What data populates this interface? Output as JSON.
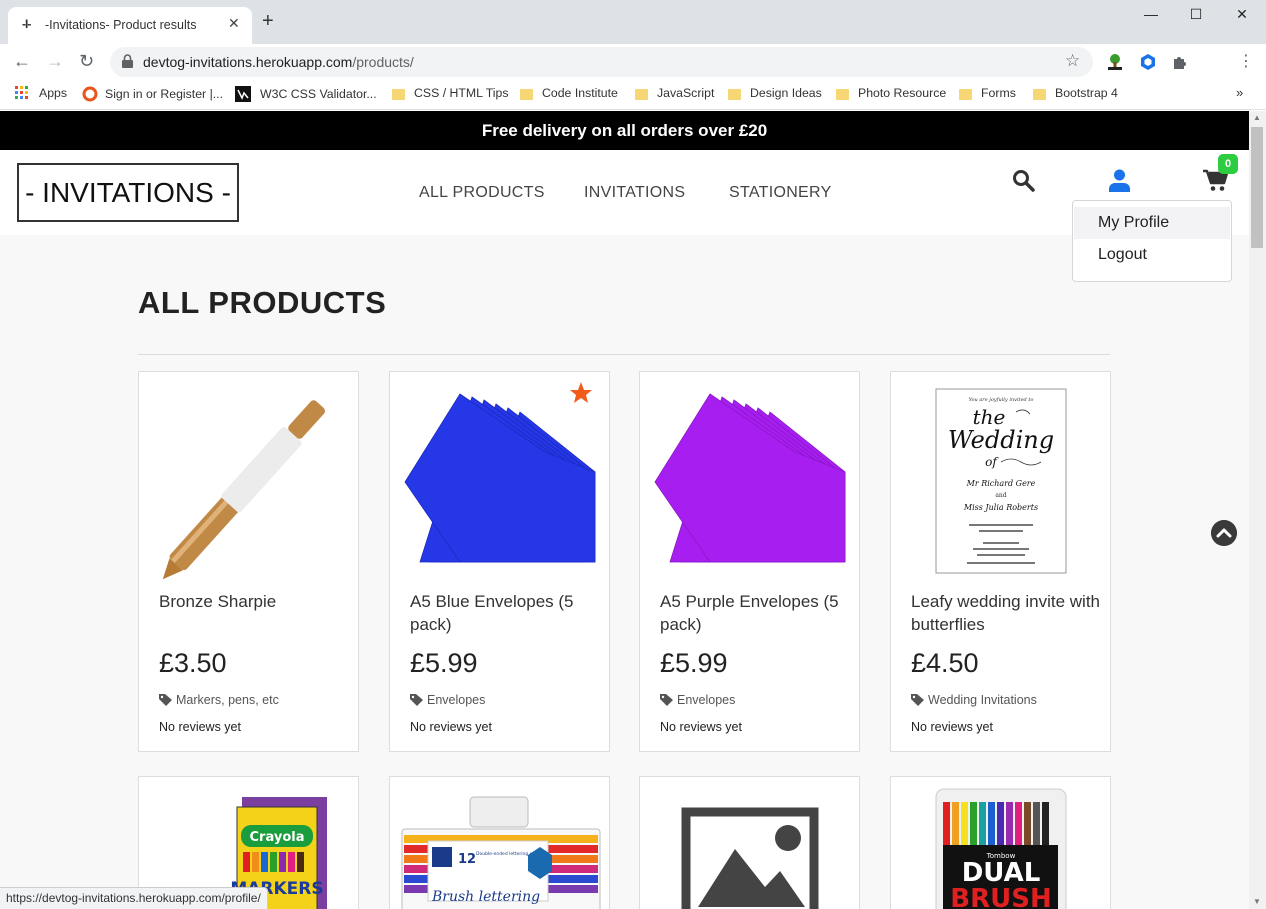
{
  "browser": {
    "tab_title": "-Invitations- Product results",
    "tab_favicon": "-I-",
    "url_host": "devtog-invitations.herokuapp.com",
    "url_path": "/products/",
    "status_url": "https://devtog-invitations.herokuapp.com/profile/",
    "bookmarks": [
      {
        "label": "Apps",
        "icon": "apps-grid-icon"
      },
      {
        "label": "Sign in or Register |...",
        "icon": "circle-logo-icon"
      },
      {
        "label": "W3C CSS Validator...",
        "icon": "w3c-icon"
      },
      {
        "label": "CSS / HTML Tips",
        "icon": "folder-icon"
      },
      {
        "label": "Code Institute",
        "icon": "folder-icon"
      },
      {
        "label": "JavaScript",
        "icon": "folder-icon"
      },
      {
        "label": "Design Ideas",
        "icon": "folder-icon"
      },
      {
        "label": "Photo Resource",
        "icon": "folder-icon"
      },
      {
        "label": "Forms",
        "icon": "folder-icon"
      },
      {
        "label": "Bootstrap 4",
        "icon": "folder-icon"
      }
    ]
  },
  "site": {
    "delivery_banner": "Free delivery on all orders over £20",
    "logo": "- INVITATIONS -",
    "nav": [
      "ALL PRODUCTS",
      "INVITATIONS",
      "STATIONERY"
    ],
    "cart_count": "0",
    "account_menu": [
      "My Profile",
      "Logout"
    ],
    "colors": {
      "accent_blue": "#1a73e8",
      "badge_green": "#2ecc40",
      "star_orange": "#f05a1a"
    }
  },
  "main": {
    "heading": "ALL PRODUCTS",
    "products": [
      {
        "name": "Bronze Sharpie",
        "price": "£3.50",
        "category": "Markers, pens, etc",
        "reviews": "No reviews yet"
      },
      {
        "name": "A5 Blue Envelopes (5 pack)",
        "price": "£5.99",
        "category": "Envelopes",
        "reviews": "No reviews yet",
        "featured": true
      },
      {
        "name": "A5 Purple Envelopes (5 pack)",
        "price": "£5.99",
        "category": "Envelopes",
        "reviews": "No reviews yet"
      },
      {
        "name": "Leafy wedding invite with butterflies",
        "price": "£4.50",
        "category": "Wedding Invitations",
        "reviews": "No reviews yet"
      }
    ],
    "invite_text": {
      "top": "You are joyfully invited to",
      "the": "the",
      "wedding": "Wedding",
      "of": "of",
      "groom": "Mr Richard Gere",
      "and": "and",
      "bride": "Miss Julia Roberts"
    },
    "second_row_labels": {
      "crayola": "Crayola",
      "markers": "MARKERS",
      "staedtler_count": "12",
      "staedtler_text": "Double-ended lettering pens",
      "staedtler_script": "Brush lettering",
      "tombow_brand": "Tombow",
      "tombow_dual": "DUAL",
      "tombow_brush": "BRUSH"
    }
  }
}
